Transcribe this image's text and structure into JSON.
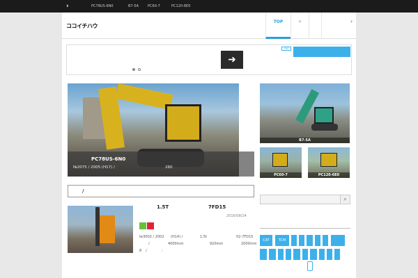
{
  "topbar": {
    "items": [
      "PC78US-6N0",
      "B7-5A",
      "PC60-7",
      "PC120-6E0"
    ]
  },
  "header": {
    "logo_text": "ココイチハウ",
    "tabs": [
      {
        "label": "TOP",
        "active": true
      },
      {
        "label": "+"
      },
      {
        "label": ""
      },
      {
        "label": "+"
      }
    ]
  },
  "banner": {
    "arrow": "➜",
    "ad_tag": "AD"
  },
  "hero": {
    "title": "PC78US-6N0",
    "meta": "№2075 / 2005 (H17) /",
    "price": "260"
  },
  "thumbs": [
    {
      "label": "B7-5A"
    },
    {
      "label": "PC60-7"
    },
    {
      "label": "PC120-6E0"
    }
  ],
  "search": {
    "value": "/"
  },
  "listing": {
    "title_left": "1.5T",
    "title_right": "7FD15",
    "date": "2016/08/24",
    "line1_a": "№3002 / 2002",
    "line1_b": "(H14) /",
    "line1_c": "1.5t",
    "line1_d": "02-7FD15",
    "line2_a": "/",
    "line2_b": "4000mm",
    "line2_c": "920mm",
    "line2_d": "2000mm",
    "line3_a": "8",
    "line3_b": "/",
    "line3_c": ":"
  },
  "sidebar": {
    "search_icon": "magnifier-icon",
    "chips": [
      "CAT",
      "TCM"
    ]
  },
  "colors": {
    "accent": "#3db0ea",
    "topbar": "#1b1b1b",
    "tag_green": "#6abf3a",
    "tag_red": "#e0233a"
  }
}
